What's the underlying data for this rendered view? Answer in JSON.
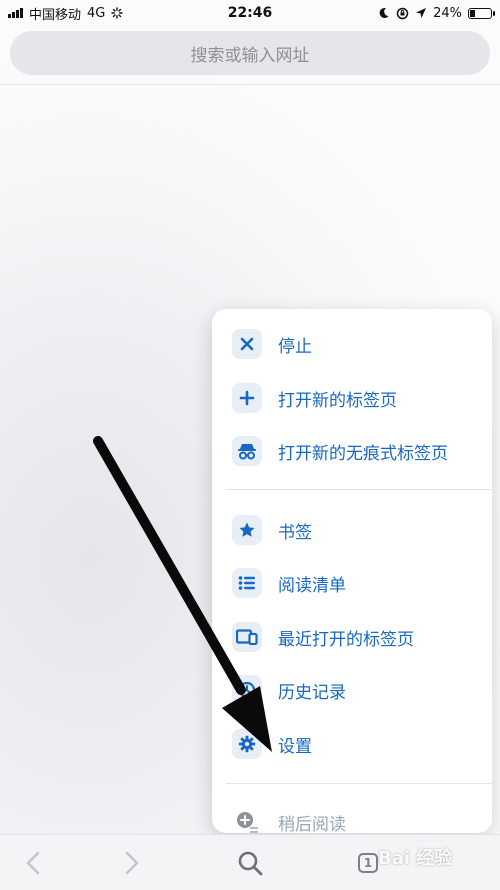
{
  "status_bar": {
    "carrier": "中国移动",
    "network": "4G",
    "time": "22:46",
    "battery": "24%",
    "battery_level": 0.24
  },
  "search": {
    "placeholder": "搜索或输入网址"
  },
  "menu": {
    "items": [
      {
        "label": "停止",
        "icon": "close-icon"
      },
      {
        "label": "打开新的标签页",
        "icon": "plus-icon"
      },
      {
        "label": "打开新的无痕式标签页",
        "icon": "incognito-icon"
      },
      {
        "label": "书签",
        "icon": "star-icon"
      },
      {
        "label": "阅读清单",
        "icon": "list-icon"
      },
      {
        "label": "最近打开的标签页",
        "icon": "devices-icon"
      },
      {
        "label": "历史记录",
        "icon": "history-icon"
      },
      {
        "label": "设置",
        "icon": "gear-icon"
      },
      {
        "label": "稍后阅读",
        "icon": "add-circle-icon"
      }
    ]
  },
  "toolbar": {
    "tab_count": "1",
    "watermark": "Bai 经验"
  },
  "colors": {
    "accent": "#1768c2",
    "menu_icon_bg": "#e8edf6",
    "search_bg": "#e5e6ea",
    "placeholder": "#8f9096"
  }
}
